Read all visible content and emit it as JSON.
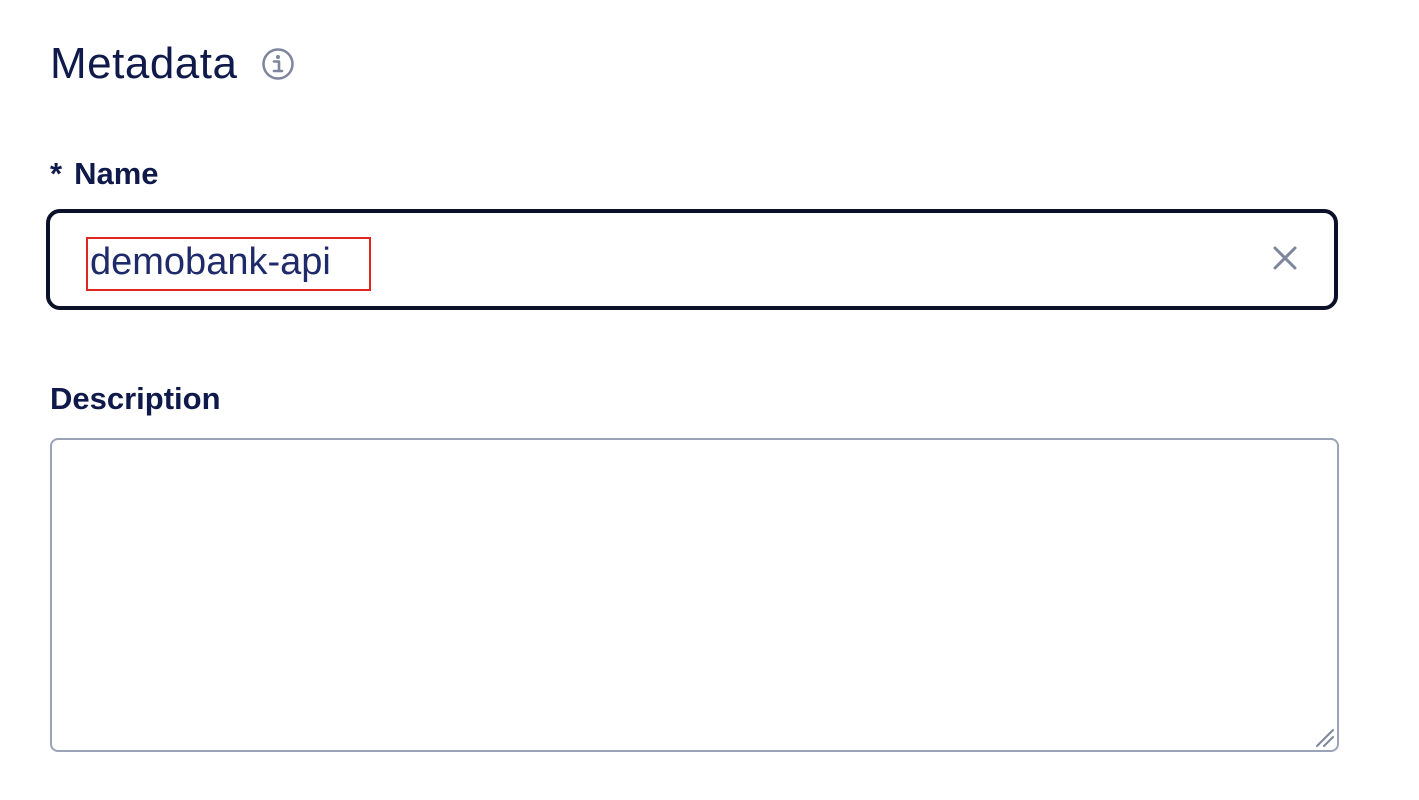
{
  "section": {
    "title": "Metadata",
    "info_icon": "info-circle-icon"
  },
  "name_field": {
    "required_mark": "*",
    "label": "Name",
    "value": "demobank-api",
    "clear_icon": "close-icon"
  },
  "description_field": {
    "label": "Description",
    "value": "",
    "resize_icon": "resize-handle-icon"
  },
  "colors": {
    "text_primary": "#0f1a4a",
    "input_text": "#1f2a6b",
    "focused_border": "#0b1128",
    "default_border": "#9aa3b8",
    "highlight": "#e0271f",
    "icon_muted": "#7d869c"
  }
}
